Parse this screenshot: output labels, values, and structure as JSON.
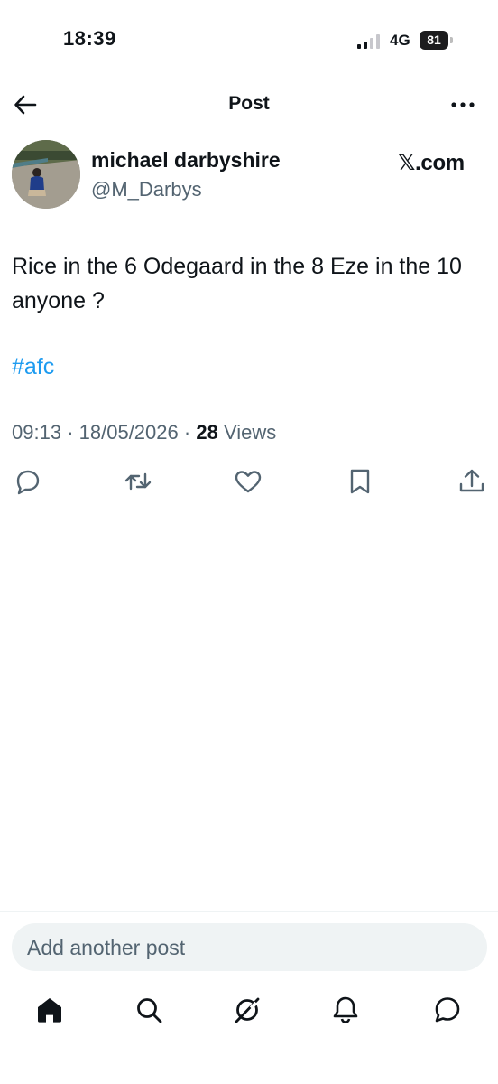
{
  "status_bar": {
    "time": "18:39",
    "network": "4G",
    "battery": "81"
  },
  "header": {
    "title": "Post"
  },
  "author": {
    "name": "michael darbyshire",
    "handle": "@M_Darbys",
    "source_label": "𝕏.com"
  },
  "post": {
    "text": "Rice in the 6 Odegaard in the 8 Eze in the 10 anyone ?",
    "hashtag": "#afc",
    "time": "09:13",
    "date": "18/05/2026",
    "views_count": "28",
    "views_label": "Views"
  },
  "actions": [
    "reply-icon",
    "repost-icon",
    "like-icon",
    "bookmark-icon",
    "share-icon"
  ],
  "composer": {
    "placeholder": "Add another post"
  },
  "tab_bar": [
    "home-icon",
    "search-icon",
    "grok-icon",
    "notifications-icon",
    "messages-icon"
  ],
  "colors": {
    "text": "#0f1419",
    "secondary": "#536471",
    "accent": "#1d9bf0",
    "input_bg": "#eff3f4"
  }
}
